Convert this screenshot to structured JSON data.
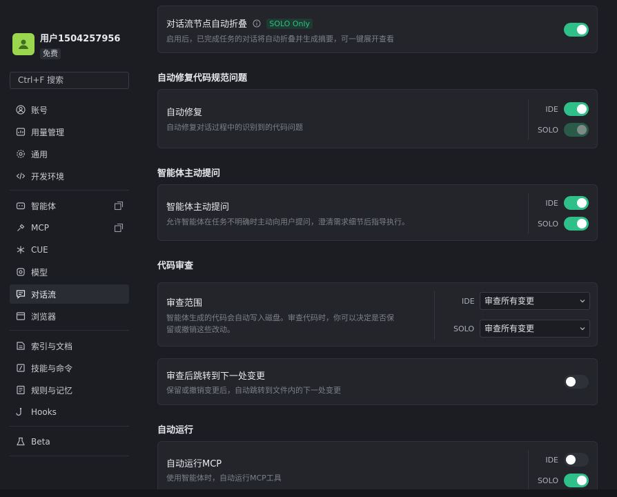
{
  "user": {
    "name": "用户1504257956",
    "plan": "免费"
  },
  "search": {
    "placeholder": "Ctrl+F 搜索"
  },
  "nav_groups": [
    [
      {
        "label": "账号",
        "icon": "account-icon"
      },
      {
        "label": "用量管理",
        "icon": "usage-icon"
      },
      {
        "label": "通用",
        "icon": "gear-icon"
      },
      {
        "label": "开发环境",
        "icon": "code-icon"
      }
    ],
    [
      {
        "label": "智能体",
        "icon": "agent-icon",
        "external": true
      },
      {
        "label": "MCP",
        "icon": "mcp-icon",
        "external": true
      },
      {
        "label": "CUE",
        "icon": "cue-icon"
      },
      {
        "label": "模型",
        "icon": "model-icon"
      },
      {
        "label": "对话流",
        "icon": "chat-flow-icon",
        "active": true
      },
      {
        "label": "浏览器",
        "icon": "browser-icon"
      }
    ],
    [
      {
        "label": "索引与文档",
        "icon": "index-icon"
      },
      {
        "label": "技能与命令",
        "icon": "skills-icon"
      },
      {
        "label": "规则与记忆",
        "icon": "rules-icon"
      },
      {
        "label": "Hooks",
        "icon": "hooks-icon"
      }
    ],
    [
      {
        "label": "Beta",
        "icon": "beta-icon"
      }
    ]
  ],
  "cards": {
    "fold": {
      "title": "对话流节点自动折叠",
      "badge": "SOLO Only",
      "desc": "启用后，已完成任务的对话将自动折叠并生成摘要，可一键展开查看",
      "toggle": "on"
    },
    "autofix": {
      "section": "自动修复代码规范问题",
      "title": "自动修复",
      "desc": "自动修复对话过程中的识别到的代码问题",
      "ide_label": "IDE",
      "ide": "on",
      "solo_label": "SOLO",
      "solo": "dim"
    },
    "ask": {
      "section": "智能体主动提问",
      "title": "智能体主动提问",
      "desc": "允许智能体在任务不明确时主动向用户提问，澄清需求细节后指导执行。",
      "ide_label": "IDE",
      "ide": "on",
      "solo_label": "SOLO",
      "solo": "on"
    },
    "review": {
      "section": "代码审查",
      "title": "审查范围",
      "desc1": "智能体生成的代码会自动写入磁盘。审查代码时，你可以决定是否保",
      "desc2": "留或撤销这些改动。",
      "ide_label": "IDE",
      "ide_value": "审查所有变更",
      "solo_label": "SOLO",
      "solo_value": "审查所有变更"
    },
    "jump": {
      "title": "审查后跳转到下一处变更",
      "desc": "保留或撤销变更后，自动跳转到文件内的下一处变更",
      "toggle": "off"
    },
    "autorun": {
      "section": "自动运行",
      "title": "自动运行MCP",
      "desc": "使用智能体时，自动运行MCP工具",
      "ide_label": "IDE",
      "ide": "off",
      "solo_label": "SOLO",
      "solo": "on"
    }
  },
  "colors": {
    "accent": "#2fbf88",
    "background": "#1c1d22",
    "card": "#23252b",
    "avatar": "#9bd64f"
  }
}
